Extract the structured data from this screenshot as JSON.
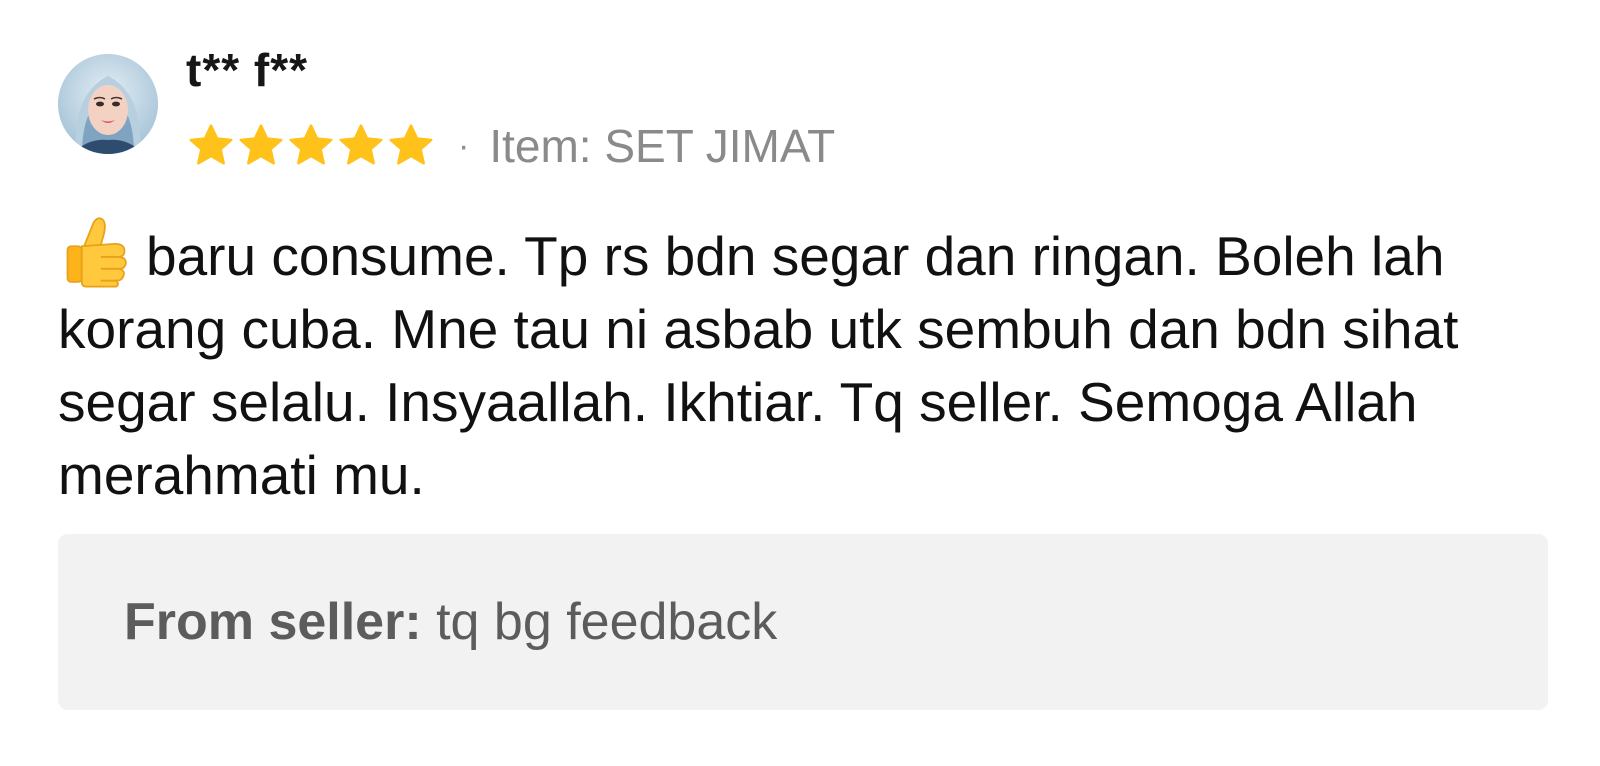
{
  "review": {
    "username": "t** f**",
    "rating": 5,
    "rating_max": 5,
    "separator": "·",
    "item_text": "Item: SET JIMAT",
    "body_text": "baru consume. Tp rs bdn segar dan ringan. Boleh lah korang cuba. Mne tau ni asbab utk sembuh dan bdn sihat segar selalu. Insyaallah. Ikhtiar. Tq seller. Semoga Allah merahmati mu.",
    "body_leading_icon": "thumbs-up-icon",
    "seller_reply": {
      "label": "From seller:",
      "text": "tq bg feedback"
    }
  },
  "colors": {
    "star": "#FFC21A",
    "meta_text": "#8a8a8a",
    "reply_box_bg": "#f2f2f2",
    "reply_text": "#5c5c5c"
  }
}
